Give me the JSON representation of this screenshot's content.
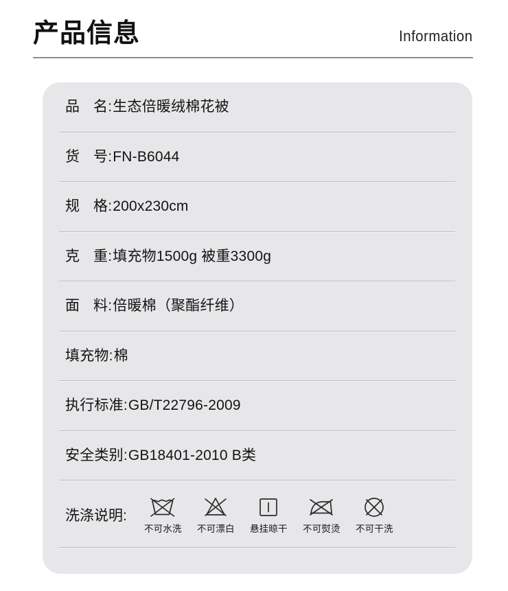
{
  "header": {
    "title": "产品信息",
    "subtitle": "Information"
  },
  "info_panel": {
    "rows": [
      {
        "label": "品",
        "label2": "名",
        "separator": ":",
        "value": "生态倍暖绒棉花被",
        "name": "product-name"
      },
      {
        "label": "货",
        "label2": "号",
        "separator": ":",
        "value": "FN-B6044",
        "name": "item-number"
      },
      {
        "label": "规",
        "label2": "格",
        "separator": ":",
        "value": "200x230cm",
        "name": "specification"
      },
      {
        "label": "克",
        "label2": "重",
        "separator": ":",
        "value": "填充物1500g 被重3300g",
        "name": "gram-weight"
      },
      {
        "label": "面",
        "label2": "料",
        "separator": ":",
        "value": "倍暖棉（聚酯纤维）",
        "name": "fabric"
      },
      {
        "label": "填充物",
        "label2": "",
        "separator": ":",
        "value": "棉",
        "name": "filling"
      },
      {
        "label": "执行标准",
        "label2": "",
        "separator": ":",
        "value": "GB/T22796-2009",
        "name": "execution-standard"
      },
      {
        "label": "安全类别",
        "label2": "",
        "separator": ":",
        "value": "GB18401-2010 B类",
        "name": "safety-category"
      }
    ],
    "care": {
      "label": "洗涤说明:",
      "items": [
        {
          "icon": "do-not-wash-icon",
          "text": "不可水洗"
        },
        {
          "icon": "do-not-bleach-icon",
          "text": "不可漂白"
        },
        {
          "icon": "line-dry-icon",
          "text": "悬挂晾干"
        },
        {
          "icon": "do-not-iron-icon",
          "text": "不可熨烫"
        },
        {
          "icon": "do-not-dry-clean-icon",
          "text": "不可干洗"
        }
      ]
    }
  },
  "colors": {
    "panel_bg": "#e7e7e9",
    "divider": "#bcbcc0",
    "header_rule": "#8d8d8d",
    "text": "#131313"
  }
}
